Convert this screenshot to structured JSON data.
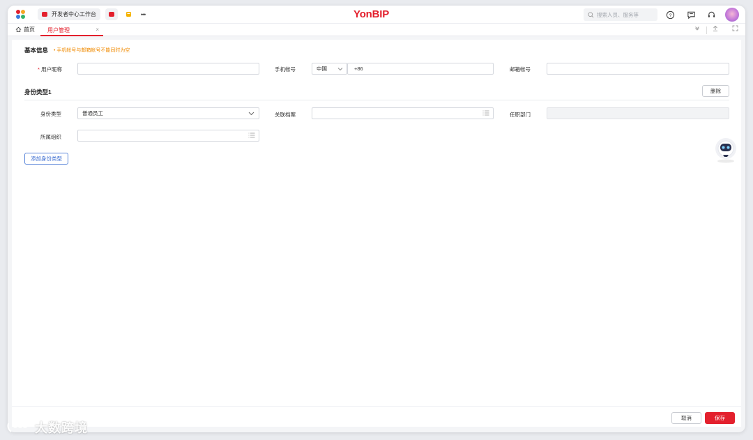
{
  "header": {
    "tabs": [
      {
        "label": "开发者中心工作台"
      },
      {
        "label": ""
      },
      {
        "label": ""
      }
    ],
    "more": "•••",
    "logo": "YonBIP",
    "search_placeholder": "搜索人员、服务等"
  },
  "page_tabs": {
    "home": "首页",
    "active": "用户管理",
    "close": "×"
  },
  "basic_info": {
    "title": "基本信息",
    "hint": "手机帐号与邮箱帐号不能同时为空",
    "nickname_label": "用户昵称",
    "nickname_value": "",
    "phone_label": "手机帐号",
    "country": "中国",
    "phone_prefix": "+86",
    "email_label": "邮箱帐号",
    "email_value": ""
  },
  "identity": {
    "title": "身份类型1",
    "delete_label": "删除",
    "type_label": "身份类型",
    "type_value": "普通员工",
    "archive_label": "关联档案",
    "dept_label": "任职部门",
    "org_label": "所属组织",
    "add_label": "添加身份类型"
  },
  "footer": {
    "cancel": "取消",
    "save": "保存"
  },
  "watermark": "大数跨境",
  "colors": {
    "brand": "#e3202d",
    "hint": "#f08a00",
    "link_blue": "#3a6bd0"
  }
}
